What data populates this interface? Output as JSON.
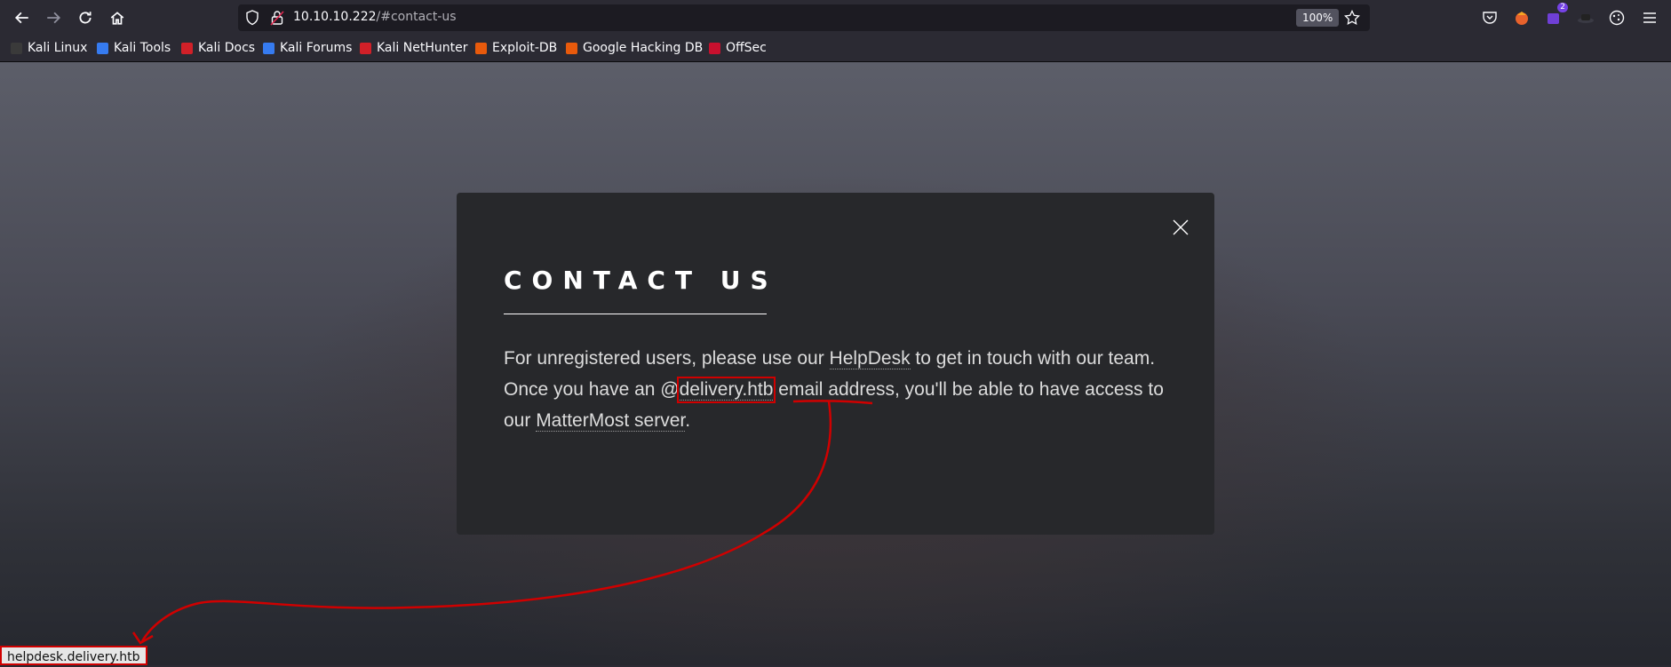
{
  "browser": {
    "url_host": "10.10.10.222",
    "url_path": "/#contact-us",
    "zoom": "100%",
    "extension_badge": "2",
    "bookmarks": [
      {
        "label": "Kali Linux",
        "color": "#3a3a3a"
      },
      {
        "label": "Kali Tools",
        "color": "#367bf0"
      },
      {
        "label": "Kali Docs",
        "color": "#d12028"
      },
      {
        "label": "Kali Forums",
        "color": "#367bf0"
      },
      {
        "label": "Kali NetHunter",
        "color": "#d12028"
      },
      {
        "label": "Exploit-DB",
        "color": "#e85a0c"
      },
      {
        "label": "Google Hacking DB",
        "color": "#e85a0c"
      },
      {
        "label": "OffSec",
        "color": "#c8102e"
      }
    ]
  },
  "modal": {
    "title": "CONTACT US",
    "text_1": "For unregistered users, please use our ",
    "helpdesk_link": "HelpDesk",
    "text_2": " to get in touch with our team. Once you have an @",
    "domain_link": "delivery.htb",
    "text_3": " email address, you'll be able to have access to our ",
    "mattermost_link": "MatterMost server",
    "text_4": "."
  },
  "status_bar": {
    "link_url": "helpdesk.delivery.htb"
  },
  "colors": {
    "annotation": "#d00000",
    "modal_bg": "#27282b",
    "chrome_bg": "#2b2a33"
  }
}
